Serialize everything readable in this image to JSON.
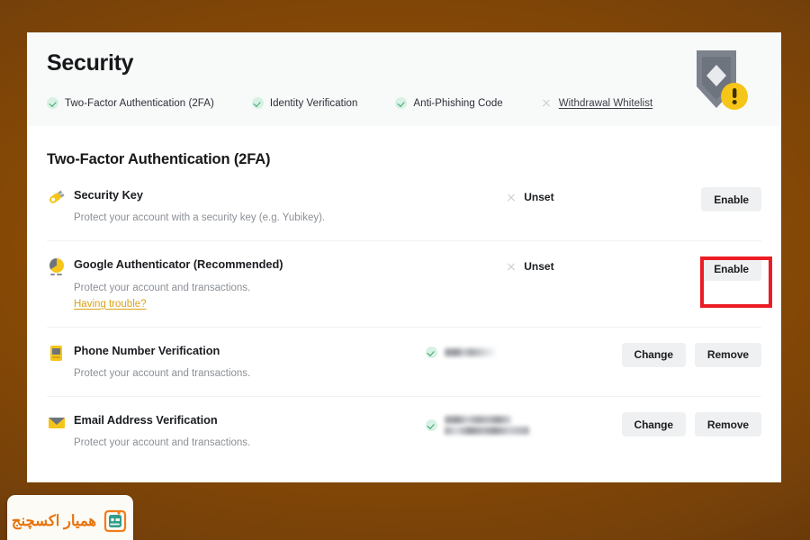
{
  "page": {
    "title": "Security",
    "background_color": "#8a4b04",
    "card_background": "#ffffff"
  },
  "header": {
    "title": "Security",
    "shield_icon": "shield-warning-icon",
    "tabs": [
      {
        "label": "Two-Factor Authentication (2FA)",
        "status_icon": "check-circle-icon",
        "state": "done"
      },
      {
        "label": "Identity Verification",
        "status_icon": "check-circle-icon",
        "state": "done"
      },
      {
        "label": "Anti-Phishing Code",
        "status_icon": "check-circle-icon",
        "state": "done"
      },
      {
        "label": "Withdrawal Whitelist",
        "status_icon": "x-icon",
        "state": "pending"
      }
    ]
  },
  "main": {
    "section_title": "Two-Factor Authentication (2FA)",
    "rows": [
      {
        "icon": "security-key-icon",
        "title": "Security Key",
        "description": "Protect your account with a security key (e.g. Yubikey).",
        "link": null,
        "status_icon": "x-icon",
        "status_text": "Unset",
        "value_redacted": false,
        "actions": [
          {
            "label": "Enable",
            "name": "enable-button"
          }
        ],
        "highlighted": false
      },
      {
        "icon": "google-authenticator-icon",
        "title": "Google Authenticator (Recommended)",
        "description": "Protect your account and transactions.",
        "link": "Having trouble?",
        "status_icon": "x-icon",
        "status_text": "Unset",
        "value_redacted": false,
        "actions": [
          {
            "label": "Enable",
            "name": "enable-button"
          }
        ],
        "highlighted": true
      },
      {
        "icon": "phone-icon",
        "title": "Phone Number Verification",
        "description": "Protect your account and transactions.",
        "link": null,
        "status_icon": "check-circle-icon",
        "status_text": "",
        "value_redacted": true,
        "actions": [
          {
            "label": "Change",
            "name": "change-button"
          },
          {
            "label": "Remove",
            "name": "remove-button"
          }
        ],
        "highlighted": false
      },
      {
        "icon": "email-icon",
        "title": "Email Address Verification",
        "description": "Protect your account and transactions.",
        "link": null,
        "status_icon": "check-circle-icon",
        "status_text": "",
        "value_redacted": true,
        "actions": [
          {
            "label": "Change",
            "name": "change-button"
          },
          {
            "label": "Remove",
            "name": "remove-button"
          }
        ],
        "highlighted": false
      }
    ]
  },
  "annotation": {
    "type": "red-highlight-box",
    "color": "#ec1c24",
    "targets": "enable-button-google-authenticator"
  },
  "watermark": {
    "text": "همیار اکسچنج",
    "logo_icon": "hamyar-exchange-logo",
    "text_color": "#e8720c",
    "logo_color": "#2f9e8f"
  }
}
